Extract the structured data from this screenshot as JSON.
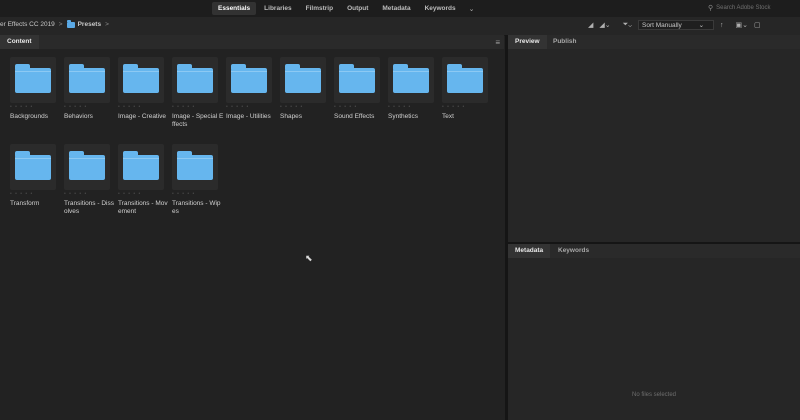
{
  "workspaces": {
    "tabs": [
      "Essentials",
      "Libraries",
      "Filmstrip",
      "Output",
      "Metadata",
      "Keywords"
    ],
    "active": "Essentials",
    "more_icon": "chevron-down-icon"
  },
  "search": {
    "placeholder": "Search Adobe Stock",
    "icon": "search-icon"
  },
  "path": {
    "crumb1": "er Effects CC 2019",
    "crumb2": "Presets",
    "sep": ">"
  },
  "toolbar": {
    "sort_label": "Sort Manually",
    "sort_arrow": "↑"
  },
  "content_panel": {
    "tab": "Content"
  },
  "preview_panel": {
    "tabs": [
      "Preview",
      "Publish"
    ]
  },
  "metadata_panel": {
    "tabs": [
      "Metadata",
      "Keywords"
    ],
    "empty_text": "No files selected"
  },
  "stars": "• • • • •",
  "items": [
    "Backgrounds",
    "Behaviors",
    "Image - Creative",
    "Image - Special Effects",
    "Image - Utilities",
    "Shapes",
    "Sound Effects",
    "Synthetics",
    "Text",
    "Transform",
    "Transitions - Dissolves",
    "Transitions - Movement",
    "Transitions - Wipes"
  ],
  "colors": {
    "folder": "#66b6ee",
    "background": "#222222"
  }
}
